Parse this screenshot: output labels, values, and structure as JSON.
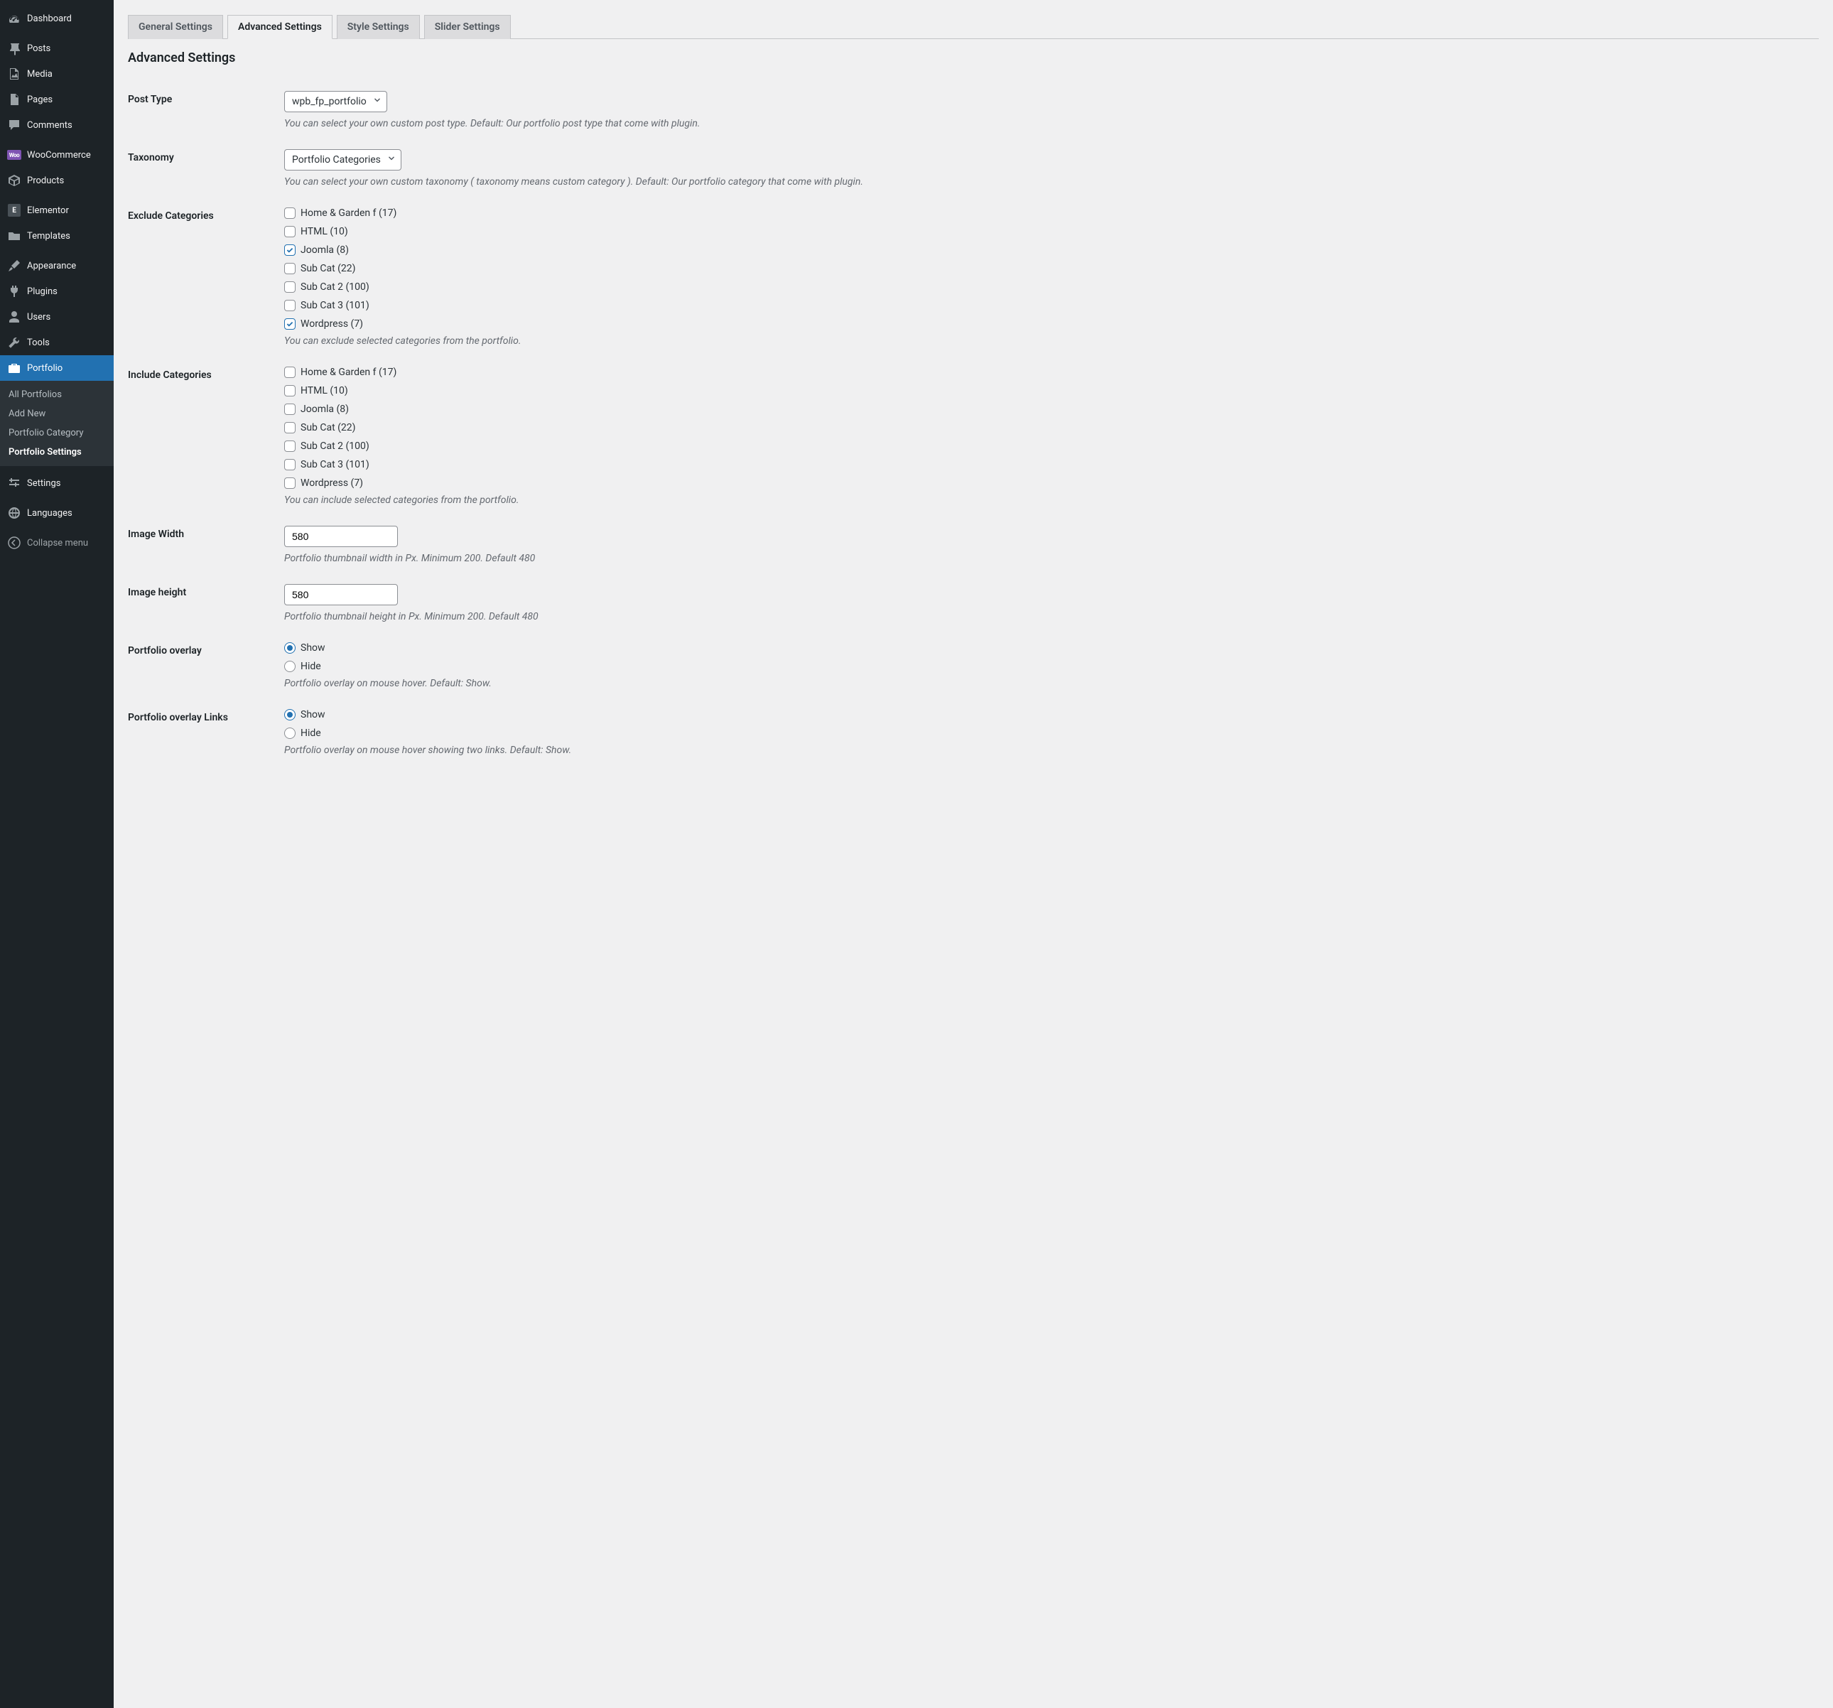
{
  "sidebar": {
    "items": [
      {
        "label": "Dashboard",
        "icon": "dashboard"
      },
      {
        "label": "Posts",
        "icon": "pin"
      },
      {
        "label": "Media",
        "icon": "media"
      },
      {
        "label": "Pages",
        "icon": "pages"
      },
      {
        "label": "Comments",
        "icon": "comment"
      },
      {
        "label": "WooCommerce",
        "icon": "woo"
      },
      {
        "label": "Products",
        "icon": "box"
      },
      {
        "label": "Elementor",
        "icon": "elementor"
      },
      {
        "label": "Templates",
        "icon": "folder"
      },
      {
        "label": "Appearance",
        "icon": "brush"
      },
      {
        "label": "Plugins",
        "icon": "plug"
      },
      {
        "label": "Users",
        "icon": "user"
      },
      {
        "label": "Tools",
        "icon": "wrench"
      },
      {
        "label": "Portfolio",
        "icon": "portfolio",
        "active": true
      },
      {
        "label": "Settings",
        "icon": "sliders"
      },
      {
        "label": "Languages",
        "icon": "languages"
      }
    ],
    "submenu": [
      {
        "label": "All Portfolios"
      },
      {
        "label": "Add New"
      },
      {
        "label": "Portfolio Category"
      },
      {
        "label": "Portfolio Settings",
        "current": true
      }
    ],
    "collapse": "Collapse menu"
  },
  "tabs": [
    {
      "label": "General Settings"
    },
    {
      "label": "Advanced Settings",
      "active": true
    },
    {
      "label": "Style Settings"
    },
    {
      "label": "Slider Settings"
    }
  ],
  "page_title": "Advanced Settings",
  "fields": {
    "post_type": {
      "label": "Post Type",
      "value": "wpb_fp_portfolio",
      "desc": "You can select your own custom post type. Default: Our portfolio post type that come with plugin."
    },
    "taxonomy": {
      "label": "Taxonomy",
      "value": "Portfolio Categories",
      "desc": "You can select your own custom taxonomy ( taxonomy means custom category ). Default: Our portfolio category that come with plugin."
    },
    "exclude": {
      "label": "Exclude Categories",
      "items": [
        {
          "label": "Home & Garden f (17)",
          "checked": false
        },
        {
          "label": "HTML (10)",
          "checked": false
        },
        {
          "label": "Joomla (8)",
          "checked": true
        },
        {
          "label": "Sub Cat (22)",
          "checked": false
        },
        {
          "label": "Sub Cat 2 (100)",
          "checked": false
        },
        {
          "label": "Sub Cat 3 (101)",
          "checked": false
        },
        {
          "label": "Wordpress (7)",
          "checked": true
        }
      ],
      "desc": "You can exclude selected categories from the portfolio."
    },
    "include": {
      "label": "Include Categories",
      "items": [
        {
          "label": "Home & Garden f (17)",
          "checked": false
        },
        {
          "label": "HTML (10)",
          "checked": false
        },
        {
          "label": "Joomla (8)",
          "checked": false
        },
        {
          "label": "Sub Cat (22)",
          "checked": false
        },
        {
          "label": "Sub Cat 2 (100)",
          "checked": false
        },
        {
          "label": "Sub Cat 3 (101)",
          "checked": false
        },
        {
          "label": "Wordpress (7)",
          "checked": false
        }
      ],
      "desc": "You can include selected categories from the portfolio."
    },
    "image_width": {
      "label": "Image Width",
      "value": "580",
      "desc": "Portfolio thumbnail width in Px. Minimum 200. Default 480"
    },
    "image_height": {
      "label": "Image height",
      "value": "580",
      "desc": "Portfolio thumbnail height in Px. Minimum 200. Default 480"
    },
    "overlay": {
      "label": "Portfolio overlay",
      "options": [
        {
          "label": "Show",
          "checked": true
        },
        {
          "label": "Hide",
          "checked": false
        }
      ],
      "desc": "Portfolio overlay on mouse hover. Default: Show."
    },
    "overlay_links": {
      "label": "Portfolio overlay Links",
      "options": [
        {
          "label": "Show",
          "checked": true
        },
        {
          "label": "Hide",
          "checked": false
        }
      ],
      "desc": "Portfolio overlay on mouse hover showing two links. Default: Show."
    }
  }
}
